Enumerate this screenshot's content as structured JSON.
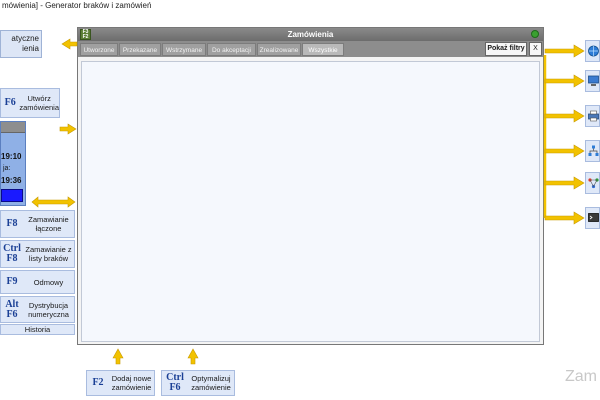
{
  "app": {
    "window_title": "mówienia] - Generator braków i zamówień"
  },
  "left_panel": {
    "auto_label": "atyczne\nienia",
    "create_button": {
      "key": "F6",
      "label": "Utwórz zamówienia"
    },
    "info": {
      "time1": "19:10",
      "time2_label": "ja:",
      "time2": "19:36"
    },
    "buttons": [
      {
        "key": "F8",
        "label": "Zamawianie łączone"
      },
      {
        "key": "Ctrl F8",
        "label": "Zamawianie z listy braków"
      },
      {
        "key": "F9",
        "label": "Odmowy"
      },
      {
        "key": "Alt F6",
        "label": "Dystrybucja numeryczna"
      }
    ],
    "history_label": "Historia"
  },
  "window": {
    "badge": "F3\nF2",
    "title": "Zamówienia",
    "tabs": [
      "Utworzone",
      "Przekazane",
      "Wstrzymane",
      "Do akceptacji",
      "Zrealizowane",
      "Wszystkie"
    ],
    "active_tab": "Wszystkie",
    "filter_button": "Pokaż filtry",
    "close_button": "X"
  },
  "bottom_buttons": [
    {
      "key": "F2",
      "label": "Dodaj nowe zamówienie"
    },
    {
      "key": "Ctrl F6",
      "label": "Optymalizuj zamówienie"
    }
  ],
  "right_icons": [
    "globe-icon",
    "monitor-icon",
    "printer-icon",
    "hierarchy-icon",
    "network-icon",
    "terminal-icon"
  ],
  "colors": {
    "arrow": "#f2c200",
    "accent_blue": "#1a3f95",
    "window_header": "#6c6c6c",
    "selection": "#1a1aff"
  },
  "watermark": "Zam"
}
